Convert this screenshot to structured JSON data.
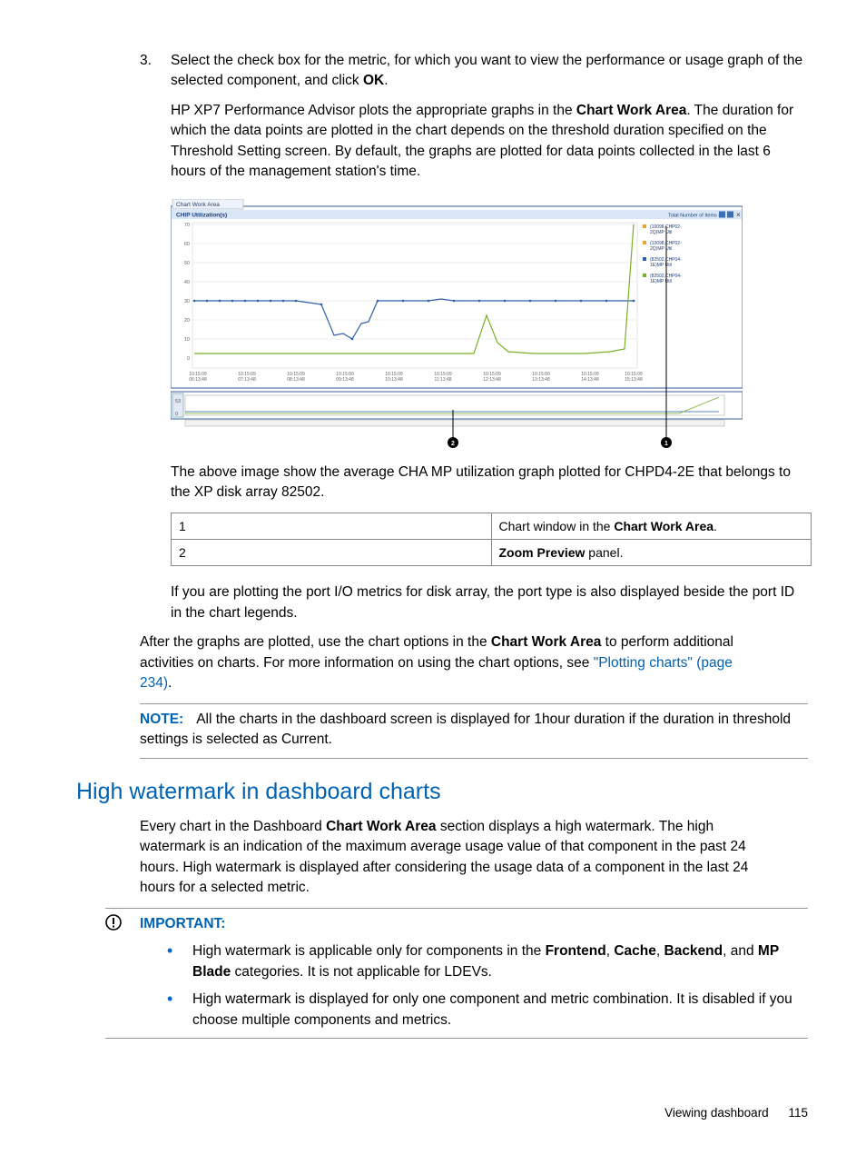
{
  "step": {
    "number": "3.",
    "text_pre": "Select the check box for the metric, for which you want to view the performance or usage graph of the selected component, and click ",
    "text_bold": "OK",
    "text_post": ".",
    "para2_pre": "HP XP7 Performance Advisor plots the appropriate graphs in the ",
    "para2_bold": "Chart Work Area",
    "para2_post": ". The duration for which the data points are plotted in the chart depends on the threshold duration specified on the Threshold Setting screen. By default, the graphs are plotted for data points collected in the last 6 hours of the management station's time."
  },
  "figure": {
    "tab_label": "Chart Work Area",
    "title": "CHIP Utilization(s)",
    "total_items": "Total Number of Items 4",
    "y_ticks": [
      "70",
      "60",
      "50",
      "40",
      "30",
      "20",
      "10",
      "0"
    ],
    "x_ticks": [
      "10:15:09\n06:13:48",
      "10:15:09\n07:13:48",
      "10:15:09\n08:13:48",
      "10:15:09\n09:13:48",
      "10:15:09\n10:13:48",
      "10:15:09\n11:13:48",
      "10:15:09\n12:13:48",
      "10:15:09\n13:13:48",
      "10:15:09\n14:13:48",
      "10:15:09\n15:13:48"
    ],
    "legend": [
      "(10098,CHP02-2Q)MP Util",
      "(10098,CHP02-2Q)MP Util",
      "(82502,CHP04-1E)MP Util",
      "(82502,CHP04-1E)MP Util"
    ],
    "callouts": [
      "2",
      "1"
    ]
  },
  "chart_data": {
    "type": "line",
    "title": "CHIP Utilization(s)",
    "xlabel": "",
    "ylabel": "",
    "ylim": [
      0,
      70
    ],
    "x": [
      1,
      2,
      3,
      4,
      5,
      6,
      7,
      8,
      9,
      10,
      11,
      12,
      13,
      14,
      15,
      16,
      17,
      18,
      19,
      20,
      21,
      22,
      23,
      24,
      25,
      26,
      27,
      28,
      29,
      30,
      31,
      32,
      33,
      34,
      35,
      36
    ],
    "series": [
      {
        "name": "(10098,CHP02-2Q)MP Util",
        "values": [
          30,
          30,
          30,
          30,
          30,
          30,
          30,
          30,
          30,
          29,
          28,
          12,
          13,
          10,
          18,
          19,
          30,
          30,
          30,
          30,
          30,
          31,
          30,
          30,
          30,
          30,
          30,
          30,
          30,
          30,
          30,
          30,
          30,
          30,
          30,
          30
        ]
      },
      {
        "name": "(82502,CHP04-1E)MP Util",
        "values": [
          3,
          3,
          3,
          3,
          3,
          3,
          3,
          3,
          3,
          3,
          3,
          3,
          3,
          3,
          3,
          3,
          3,
          3,
          3,
          3,
          3,
          3,
          3,
          22,
          8,
          4,
          3,
          3,
          3,
          3,
          3,
          3,
          3,
          3,
          5,
          70
        ]
      }
    ]
  },
  "after_figure": "The above image show the average CHA MP utilization graph plotted for CHPD4-2E that belongs to the XP disk array 82502.",
  "callout_table": {
    "r1c1": "1",
    "r1c2_pre": "Chart window in the ",
    "r1c2_bold": "Chart Work Area",
    "r1c2_post": ".",
    "r2c1": "2",
    "r2c2_bold": "Zoom Preview",
    "r2c2_post": " panel."
  },
  "port_para": "If you are plotting the port I/O metrics for disk array, the port type is also displayed beside the port ID in the chart legends.",
  "after_para_pre": "After the graphs are plotted, use the chart options in the ",
  "after_para_bold": "Chart Work Area",
  "after_para_mid": " to perform additional activities on charts. For more information on using the chart options, see ",
  "after_para_link": "\"Plotting charts\" (page 234)",
  "after_para_post": ".",
  "note": {
    "label": "NOTE:",
    "text": "All the charts in the dashboard screen is displayed for 1hour duration if the duration in threshold settings is selected as Current."
  },
  "section": {
    "heading": "High watermark in dashboard charts",
    "intro_pre": "Every chart in the Dashboard ",
    "intro_bold": "Chart Work Area",
    "intro_post": " section displays a high watermark. The high watermark is an indication of the maximum average usage value of that component in the past 24 hours. High watermark is displayed after considering the usage data of a component in the last 24 hours for a selected metric."
  },
  "important": {
    "label": "IMPORTANT:",
    "b1_pre": "High watermark is applicable only for components in the ",
    "b1_b1": "Frontend",
    "b1_s1": ", ",
    "b1_b2": "Cache",
    "b1_s2": ", ",
    "b1_b3": "Backend",
    "b1_s3": ", and ",
    "b1_b4": "MP Blade",
    "b1_post": " categories. It is not applicable for LDEVs.",
    "b2": "High watermark is displayed for only one component and metric combination. It is disabled if you choose multiple components and metrics."
  },
  "footer": {
    "section": "Viewing dashboard",
    "page": "115"
  }
}
